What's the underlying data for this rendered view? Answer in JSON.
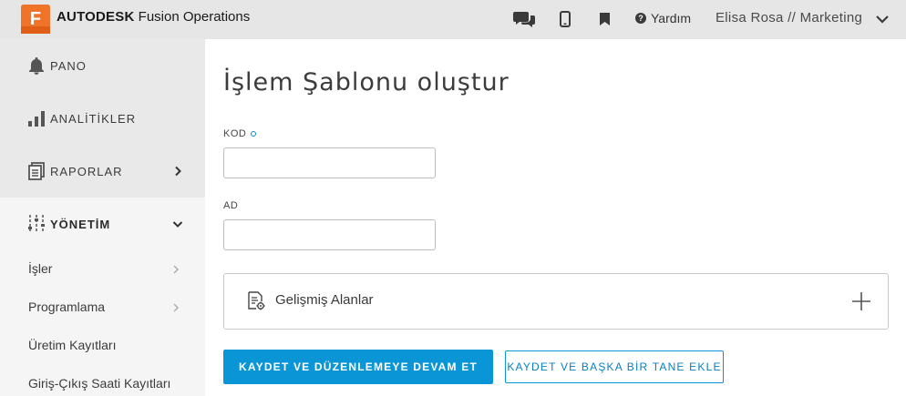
{
  "app": {
    "logo_letter": "F",
    "brand_bold": "AUTODESK",
    "brand_rest": "Fusion Operations",
    "accent_color": "#f0732a",
    "primary_color": "#0a96d6"
  },
  "header": {
    "icons": [
      "chat-icon",
      "mobile-icon",
      "bookmark-icon"
    ],
    "help_label": "Yardım",
    "user_label": "Elisa Rosa // Marketing"
  },
  "sidebar": {
    "main_items": [
      {
        "label": "PANO",
        "icon": "bell-icon"
      },
      {
        "label": "ANALİTİKLER",
        "icon": "bar-chart-icon"
      },
      {
        "label": "RAPORLAR",
        "icon": "reports-icon"
      },
      {
        "label": "YÖNETİM",
        "icon": "sliders-icon",
        "expanded": true
      }
    ],
    "sub_items": [
      {
        "label": "İşler"
      },
      {
        "label": "Programlama"
      },
      {
        "label": "Üretim Kayıtları"
      },
      {
        "label": "Giriş-Çıkış Saati Kayıtları"
      }
    ]
  },
  "main": {
    "title": "İşlem Şablonu oluştur",
    "fields": [
      {
        "label": "KOD",
        "value": "",
        "required": true
      },
      {
        "label": "AD",
        "value": "",
        "required": false
      }
    ],
    "advanced_label": "Gelişmiş Alanlar",
    "save_continue_label": "KAYDET VE DÜZENLEMEYE DEVAM ET",
    "save_add_label": "KAYDET VE BAŞKA BİR TANE EKLE"
  }
}
